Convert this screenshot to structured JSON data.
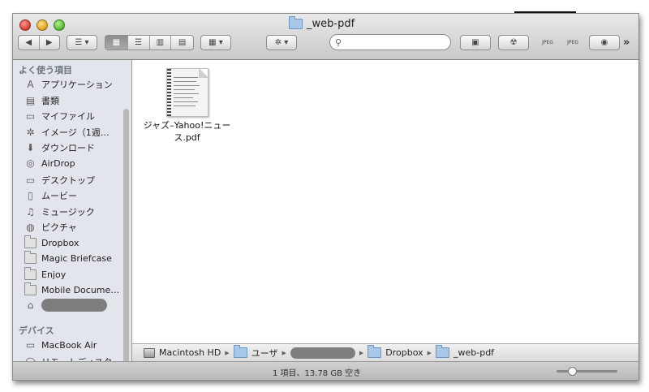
{
  "window": {
    "title": "_web-pdf"
  },
  "toolbar": {
    "back_glyph": "◀",
    "forward_glyph": "▶",
    "list_menu_glyph": "☰ ▾",
    "view_icon": "▦",
    "view_list": "☰",
    "view_columns": "▥",
    "view_coverflow": "▤",
    "arrange_glyph": "▦ ▾",
    "action_glyph": "✲ ▾",
    "search_glyph": "⚲",
    "search_placeholder": "",
    "newfolder_glyph": "▣",
    "burn_glyph": "☢",
    "jpeg1_label": "JPEG",
    "jpeg2_label": "JPEG",
    "eye_glyph": "◉",
    "overflow": "»"
  },
  "sidebar": {
    "favorites_header": "よく使う項目",
    "devices_header": "デバイス",
    "items": [
      {
        "label": "アプリケーション",
        "icon": "A"
      },
      {
        "label": "書類",
        "icon": "▤"
      },
      {
        "label": "マイファイル",
        "icon": "▭"
      },
      {
        "label": "イメージ（1週…",
        "icon": "✲"
      },
      {
        "label": "ダウンロード",
        "icon": "⬇"
      },
      {
        "label": "AirDrop",
        "icon": "◎"
      },
      {
        "label": "デスクトップ",
        "icon": "▭"
      },
      {
        "label": "ムービー",
        "icon": "▯"
      },
      {
        "label": "ミュージック",
        "icon": "♫"
      },
      {
        "label": "ピクチャ",
        "icon": "◍"
      },
      {
        "label": "Dropbox",
        "icon": ""
      },
      {
        "label": "Magic Briefcase",
        "icon": ""
      },
      {
        "label": "Enjoy",
        "icon": ""
      },
      {
        "label": "Mobile Docume…",
        "icon": ""
      }
    ],
    "home_icon": "⌂",
    "devices": [
      {
        "label": "MacBook Air",
        "icon": "▭"
      },
      {
        "label": "リモートディスク",
        "icon": "◯"
      }
    ]
  },
  "files": [
    {
      "name_line1": "ジャズ–Yahoo!ニュー",
      "name_line2": "ス.pdf"
    }
  ],
  "pathbar": {
    "items": [
      "Macintosh HD",
      "ユーザ",
      "Dropbox",
      "_web-pdf"
    ],
    "arrow": "▶"
  },
  "status": {
    "text": "1 項目、13.78 GB 空き",
    "icon_size_fraction": 0.25
  }
}
